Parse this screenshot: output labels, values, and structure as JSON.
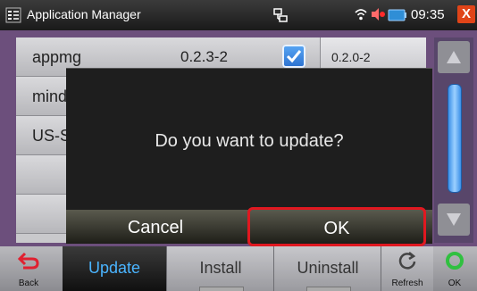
{
  "statusbar": {
    "title": "Application Manager",
    "time": "09:35",
    "close_symbol": "X",
    "icons": [
      "app-icon",
      "network-icon",
      "wifi-icon",
      "speaker-icon",
      "battery-icon",
      "close-icon"
    ]
  },
  "list": {
    "rows": [
      {
        "name": "appmg",
        "version": "0.2.3-2",
        "checked": true,
        "current_version": "0.2.0-2"
      },
      {
        "name": "mind"
      },
      {
        "name": "US-S"
      }
    ]
  },
  "dialog": {
    "message": "Do you want to update?",
    "cancel_label": "Cancel",
    "ok_label": "OK"
  },
  "toolbar": {
    "back_label": "Back",
    "tabs": [
      "Update",
      "Install",
      "Uninstall"
    ],
    "active_tab": "Update",
    "refresh_label": "Refresh",
    "ok_label": "OK"
  },
  "colors": {
    "accent": "#4ab4ff",
    "highlight_border": "#e01820",
    "frame": "#6c4f7c",
    "close": "#e04418"
  }
}
